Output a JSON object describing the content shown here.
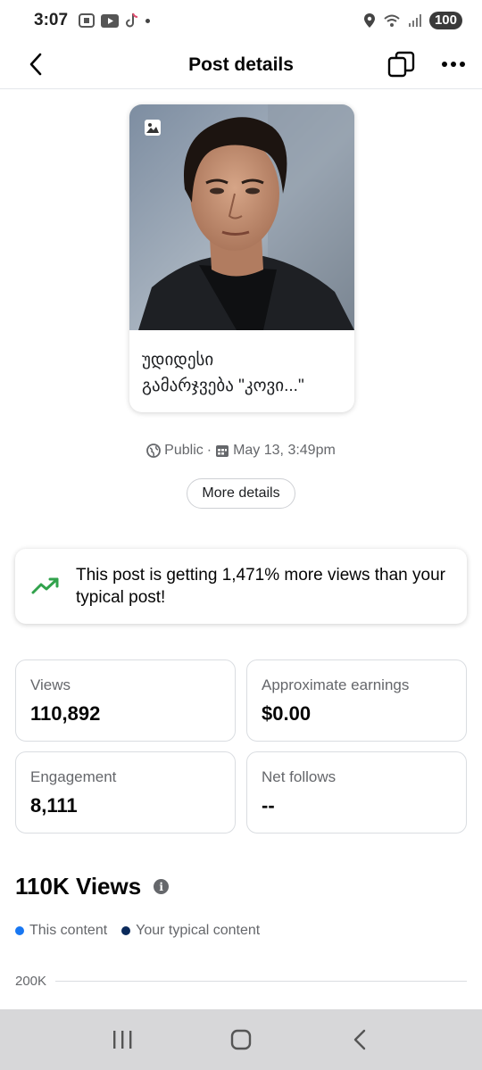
{
  "status_bar": {
    "time": "3:07",
    "battery": "100"
  },
  "header": {
    "title": "Post details"
  },
  "post": {
    "caption": "უდიდესი\nგამარჯვება \"კოვი...\"",
    "visibility": "Public",
    "separator": "·",
    "date": "May 13, 3:49pm",
    "more_details_label": "More details"
  },
  "insight": {
    "text": "This post is getting 1,471% more views than your typical post!"
  },
  "stats": [
    {
      "label": "Views",
      "value": "110,892"
    },
    {
      "label": "Approximate earnings",
      "value": "$0.00"
    },
    {
      "label": "Engagement",
      "value": "8,111"
    },
    {
      "label": "Net follows",
      "value": "--"
    }
  ],
  "views_section": {
    "title": "110K Views",
    "legend": [
      {
        "label": "This content",
        "color": "#1877f2"
      },
      {
        "label": "Your typical content",
        "color": "#0b2a5b"
      }
    ],
    "axis_top_label": "200K"
  },
  "colors": {
    "accent": "#1877f2",
    "trend_green": "#31a24c"
  }
}
